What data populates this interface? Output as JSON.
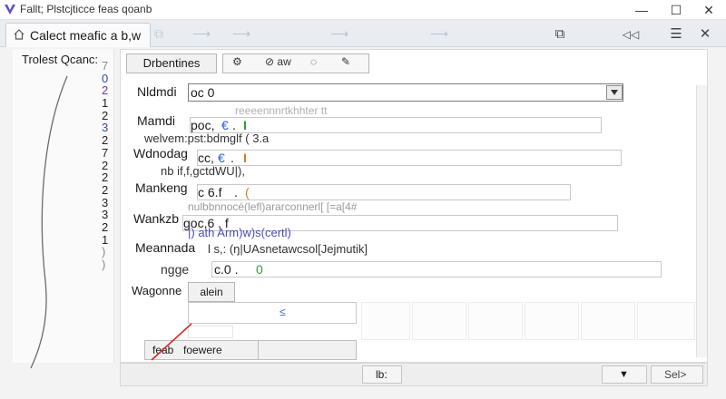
{
  "window": {
    "title": "Fallt; Plstcjticce feas qoanb",
    "minimize": "—",
    "maximize": "☐",
    "close": "✕"
  },
  "tab": {
    "label": "Calect meafic a b,w",
    "pin": "⧉"
  },
  "faint_arrows": [
    "⟶",
    "⟶",
    "⟶",
    "⟶"
  ],
  "right_tools": [
    "⧉",
    "◁◁",
    "☰",
    "✕"
  ],
  "left_panel": {
    "title": "Trolest Qcanc:",
    "gutter": [
      "7",
      "0",
      "2",
      "1",
      "2",
      "3",
      "2",
      "7",
      "2",
      "2",
      "2",
      "3",
      "3",
      "2",
      "1",
      ")",
      ")"
    ]
  },
  "toolbar": {
    "button": "Drbentines",
    "group": [
      "⚙",
      "⊘ aw",
      "◌",
      "✎"
    ]
  },
  "form": {
    "row1_label": "Nldmdi",
    "row1_value": "oc 0",
    "row1_faint": "reeeennnrtkhhter tt",
    "row2_label": "Mamdi",
    "row2_value": "poc,",
    "row2_mark1": "€",
    "row2_dot": ".",
    "row2_mark2": "I",
    "row2_sub": "welvem:pst:bdmglf ( 3.a",
    "row3_label": "Wdnodag",
    "row3_value": "cc,",
    "row3_mark1": "€",
    "row3_dot": ".",
    "row3_mark2": "I",
    "row3_sub": "nb if,f,gctdWU|),",
    "row4_label": "Mankeng",
    "row4_value": "c 6.f",
    "row4_dot": ".",
    "row4_mark": "(",
    "row4_sub": "nulbbnnocé(lefl)ararconnerl[ [=a[4#",
    "row5_label": "Wankzb",
    "row5_value": "goc,6 , f",
    "row5_sub": "|) ath Arm)w)s(certl)",
    "row6_label": "Meannada",
    "row6_text": "l s,: (ŋ|UAsnetawcsol[Jejmutik]",
    "row7_prefix": "ngge",
    "row7_value": "c.0 .",
    "row7_mark": "0",
    "wagonne_label": "Wagonne",
    "wagonne_btn": "alein",
    "small_glyph": "≤",
    "foot_left": "feab",
    "foot_right": "foewere"
  },
  "bottom": {
    "center": "lb:",
    "dropdown": "▼",
    "next": "Sel>"
  }
}
